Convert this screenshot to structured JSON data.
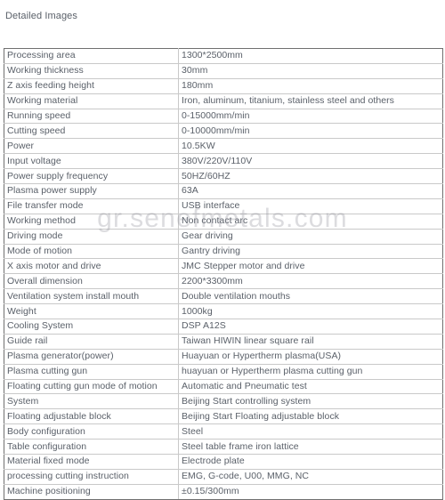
{
  "page": {
    "section_title": "Detailed Images",
    "watermark_text": "gr.senefmetals.com",
    "text_color": "#5a6069",
    "outer_border_color": "#707070",
    "inner_border_color": "#c9c9c9",
    "background_color": "#ffffff"
  },
  "spec_table": {
    "rows": [
      {
        "label": "Processing area",
        "value": "1300*2500mm"
      },
      {
        "label": "Working thickness",
        "value": "30mm"
      },
      {
        "label": "Z axis feeding height",
        "value": "180mm"
      },
      {
        "label": "Working material",
        "value": "Iron, aluminum, titanium, stainless steel and others"
      },
      {
        "label": "Running speed",
        "value": "0-15000mm/min"
      },
      {
        "label": "Cutting speed",
        "value": "0-10000mm/min"
      },
      {
        "label": "Power",
        "value": "10.5KW"
      },
      {
        "label": "Input voltage",
        "value": "380V/220V/110V"
      },
      {
        "label": "Power supply frequency",
        "value": "50HZ/60HZ"
      },
      {
        "label": "Plasma power supply",
        "value": "63A"
      },
      {
        "label": "File transfer mode",
        "value": "USB interface"
      },
      {
        "label": "Working method",
        "value": "Non contact arc"
      },
      {
        "label": "Driving mode",
        "value": "Gear driving"
      },
      {
        "label": "Mode of motion",
        "value": "Gantry driving"
      },
      {
        "label": "X axis motor and drive",
        "value": "JMC Stepper motor and drive"
      },
      {
        "label": "Overall dimension",
        "value": "2200*3300mm"
      },
      {
        "label": "Ventilation system install mouth",
        "value": "Double ventilation mouths"
      },
      {
        "label": "Weight",
        "value": "1000kg"
      },
      {
        "label": "Cooling System",
        "value": " DSP A12S"
      },
      {
        "label": "Guide rail",
        "value": "Taiwan HIWIN linear square rail"
      },
      {
        "label": "Plasma generator(power)",
        "value": "Huayuan or Hypertherm plasma(USA)"
      },
      {
        "label": "Plasma cutting gun",
        "value": "huayuan or Hypertherm plasma cutting gun"
      },
      {
        "label": "Floating cutting gun mode of motion",
        "value": "Automatic and Pneumatic test"
      },
      {
        "label": "System",
        "value": "Beijing Start controlling system"
      },
      {
        "label": "Floating adjustable block",
        "value": "Beijing Start Floating adjustable block"
      },
      {
        "label": "Body configuration",
        "value": "Steel"
      },
      {
        "label": "Table configuration",
        "value": "Steel table frame iron lattice"
      },
      {
        "label": "Material fixed mode",
        "value": "Electrode plate"
      },
      {
        "label": "processing cutting instruction",
        "value": "EMG, G-code, U00, MMG, NC"
      },
      {
        "label": "Machine positioning",
        "value": "±0.15/300mm"
      }
    ]
  }
}
